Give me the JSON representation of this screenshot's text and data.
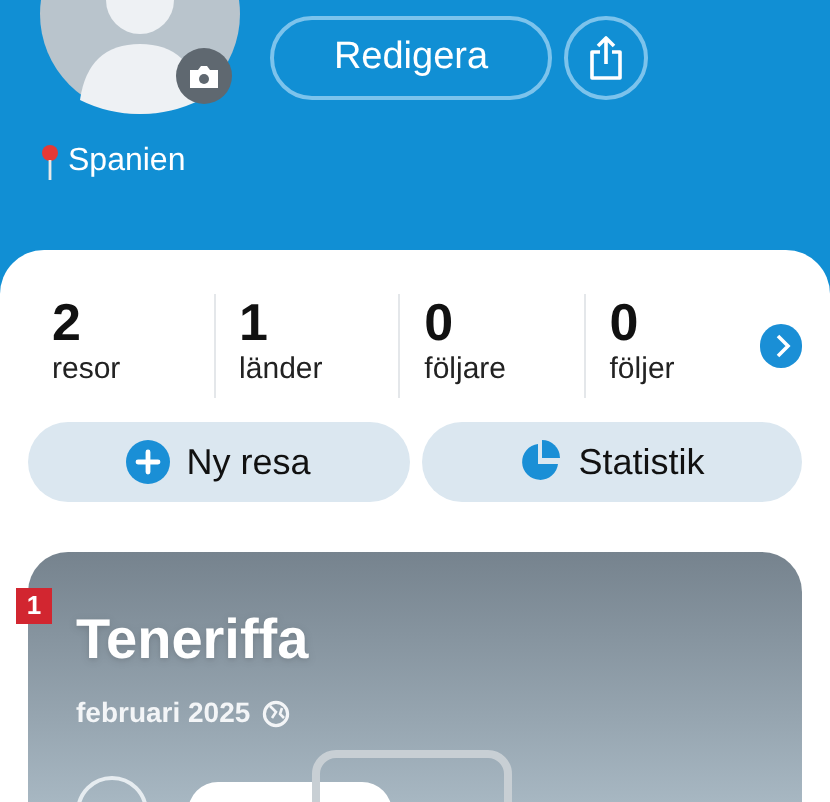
{
  "profile": {
    "edit_button": "Redigera",
    "location": "Spanien"
  },
  "stats": [
    {
      "value": "2",
      "label": "resor"
    },
    {
      "value": "1",
      "label": "länder"
    },
    {
      "value": "0",
      "label": "följare"
    },
    {
      "value": "0",
      "label": "följer"
    }
  ],
  "actions": [
    {
      "kind": "add",
      "label": "Ny resa"
    },
    {
      "kind": "stats",
      "label": "Statistik"
    }
  ],
  "trip_card": {
    "badge": "1",
    "title": "Teneriffa",
    "date": "februari 2025"
  }
}
